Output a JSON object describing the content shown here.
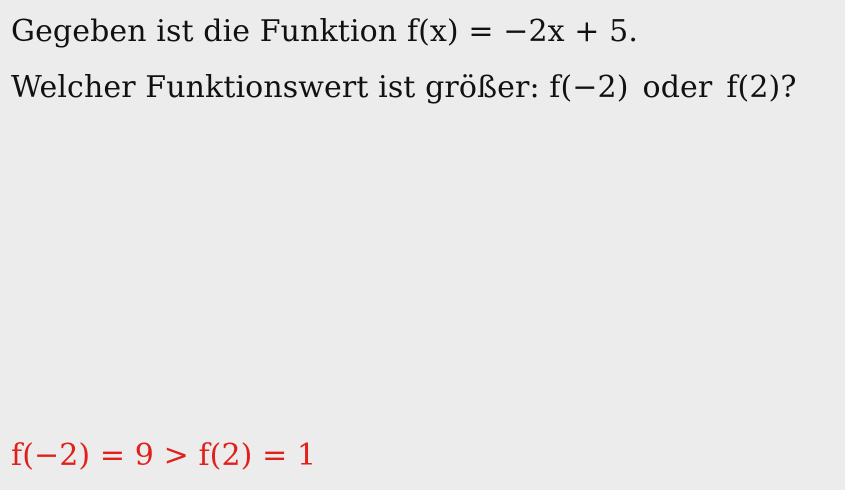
{
  "task": {
    "given_prefix": "Gegeben ist die Funktion",
    "function_definition": "f(x) = −2x + 5.",
    "question_prefix": "Welcher Funktionswert ist größer:",
    "option_a": "f(−2)",
    "connector": "oder",
    "option_b": "f(2)",
    "question_mark": "?"
  },
  "solution": {
    "text": "f(−2) = 9 > f(2) = 1",
    "color": "#e0201b"
  }
}
